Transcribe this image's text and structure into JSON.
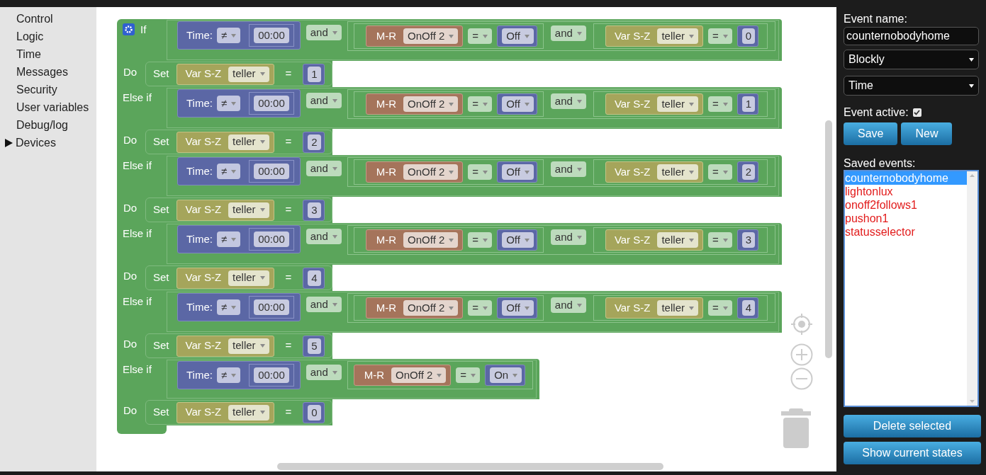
{
  "menu": [
    {
      "label": "Control",
      "kind": "link"
    },
    {
      "label": "Logic",
      "kind": "link"
    },
    {
      "label": "Time",
      "kind": "link"
    },
    {
      "label": "Messages",
      "kind": "link"
    },
    {
      "label": "Security",
      "kind": "link"
    },
    {
      "label": "User variables",
      "kind": "link"
    },
    {
      "label": "Debug/log",
      "kind": "link"
    },
    {
      "label": "Devices",
      "kind": "collapsible"
    }
  ],
  "blocks": {
    "mutator": true,
    "branches": [
      {
        "label": "If",
        "condition": {
          "time": {
            "label": "Time:",
            "operator": "≠",
            "value": "00:00"
          },
          "joiner": "and",
          "device": {
            "label": "M-R",
            "name": "OnOff 2",
            "operator": "=",
            "value": "Off"
          },
          "joiner2": "and",
          "variable": {
            "label": "Var S-Z",
            "name": "teller",
            "operator": "=",
            "value": "0"
          }
        },
        "do": {
          "label": "Do",
          "action": "Set",
          "variable": {
            "label": "Var S-Z",
            "name": "teller"
          },
          "operator": "=",
          "value": "1"
        }
      },
      {
        "label": "Else if",
        "condition": {
          "time": {
            "label": "Time:",
            "operator": "≠",
            "value": "00:00"
          },
          "joiner": "and",
          "device": {
            "label": "M-R",
            "name": "OnOff 2",
            "operator": "=",
            "value": "Off"
          },
          "joiner2": "and",
          "variable": {
            "label": "Var S-Z",
            "name": "teller",
            "operator": "=",
            "value": "1"
          }
        },
        "do": {
          "label": "Do",
          "action": "Set",
          "variable": {
            "label": "Var S-Z",
            "name": "teller"
          },
          "operator": "=",
          "value": "2"
        }
      },
      {
        "label": "Else if",
        "condition": {
          "time": {
            "label": "Time:",
            "operator": "≠",
            "value": "00:00"
          },
          "joiner": "and",
          "device": {
            "label": "M-R",
            "name": "OnOff 2",
            "operator": "=",
            "value": "Off"
          },
          "joiner2": "and",
          "variable": {
            "label": "Var S-Z",
            "name": "teller",
            "operator": "=",
            "value": "2"
          }
        },
        "do": {
          "label": "Do",
          "action": "Set",
          "variable": {
            "label": "Var S-Z",
            "name": "teller"
          },
          "operator": "=",
          "value": "3"
        }
      },
      {
        "label": "Else if",
        "condition": {
          "time": {
            "label": "Time:",
            "operator": "≠",
            "value": "00:00"
          },
          "joiner": "and",
          "device": {
            "label": "M-R",
            "name": "OnOff 2",
            "operator": "=",
            "value": "Off"
          },
          "joiner2": "and",
          "variable": {
            "label": "Var S-Z",
            "name": "teller",
            "operator": "=",
            "value": "3"
          }
        },
        "do": {
          "label": "Do",
          "action": "Set",
          "variable": {
            "label": "Var S-Z",
            "name": "teller"
          },
          "operator": "=",
          "value": "4"
        }
      },
      {
        "label": "Else if",
        "condition": {
          "time": {
            "label": "Time:",
            "operator": "≠",
            "value": "00:00"
          },
          "joiner": "and",
          "device": {
            "label": "M-R",
            "name": "OnOff 2",
            "operator": "=",
            "value": "Off"
          },
          "joiner2": "and",
          "variable": {
            "label": "Var S-Z",
            "name": "teller",
            "operator": "=",
            "value": "4"
          }
        },
        "do": {
          "label": "Do",
          "action": "Set",
          "variable": {
            "label": "Var S-Z",
            "name": "teller"
          },
          "operator": "=",
          "value": "5"
        }
      },
      {
        "label": "Else if",
        "condition": {
          "time": {
            "label": "Time:",
            "operator": "≠",
            "value": "00:00"
          },
          "joiner": "and",
          "device": {
            "label": "M-R",
            "name": "OnOff 2",
            "operator": "=",
            "value": "On"
          }
        },
        "do": {
          "label": "Do",
          "action": "Set",
          "variable": {
            "label": "Var S-Z",
            "name": "teller"
          },
          "operator": "=",
          "value": "0"
        }
      }
    ]
  },
  "panel": {
    "event_name_label": "Event name:",
    "event_name": "counternobodyhome",
    "selects": [
      "Blockly",
      "Time"
    ],
    "event_active_label": "Event active:",
    "event_active": true,
    "buttons": [
      "Save",
      "New"
    ],
    "saved_label": "Saved events:",
    "saved_events": [
      {
        "name": "counternobodyhome",
        "selected": true
      },
      {
        "name": "lightonlux",
        "selected": false
      },
      {
        "name": "onoff2follows1",
        "selected": false
      },
      {
        "name": "pushon1",
        "selected": false
      },
      {
        "name": "statusselector",
        "selected": false
      }
    ],
    "bottom_buttons": [
      "Delete selected",
      "Show current states"
    ]
  }
}
